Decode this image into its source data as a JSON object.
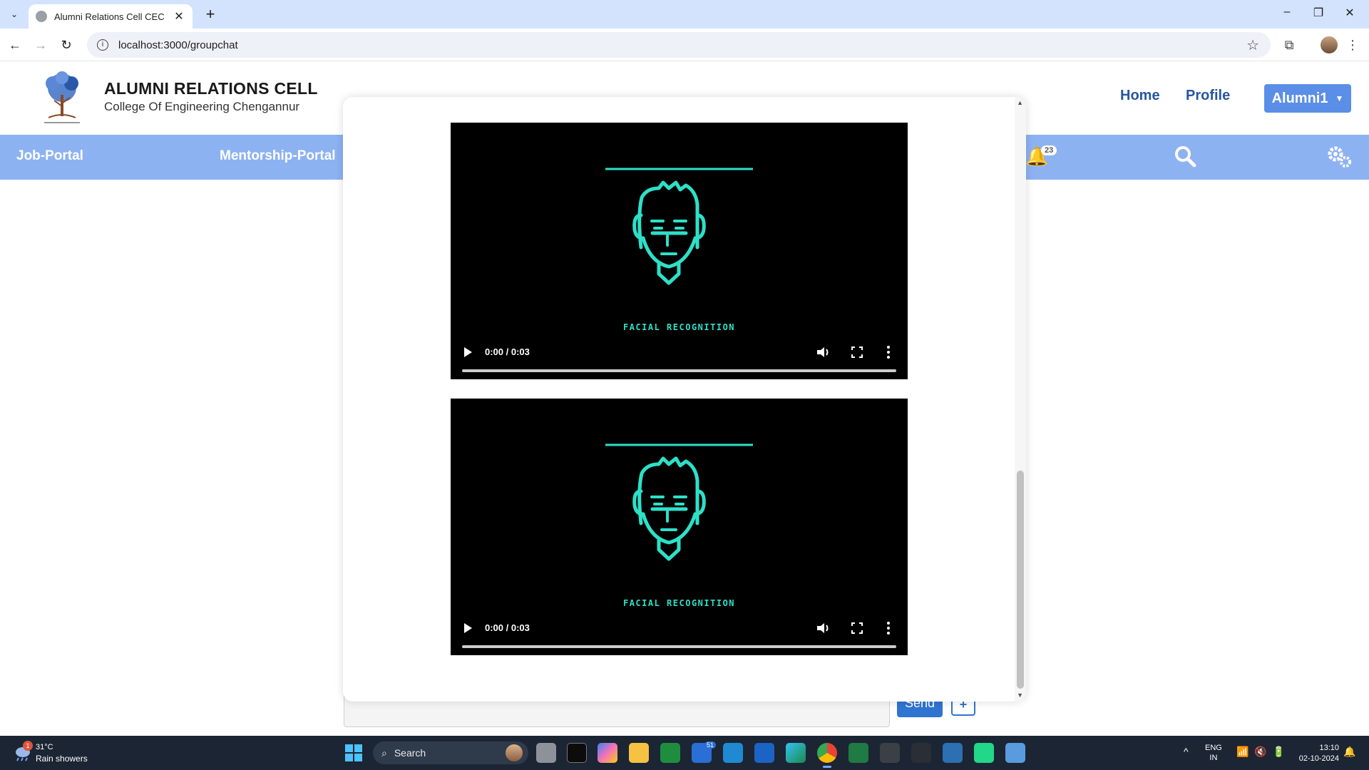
{
  "browser": {
    "tab_title": "Alumni Relations Cell CEC",
    "url": "localhost:3000/groupchat"
  },
  "header": {
    "title": "ALUMNI RELATIONS CELL",
    "subtitle": "College Of Engineering Chengannur",
    "nav": [
      "Home",
      "Profile"
    ],
    "user_button": "Alumni1"
  },
  "bluenav": {
    "links": [
      "Job-Portal",
      "Mentorship-Portal"
    ],
    "notification_count": "23"
  },
  "chat": {
    "send_label": "Send",
    "plus_label": "+"
  },
  "modal": {
    "videos": [
      {
        "caption": "FACIAL RECOGNITION",
        "time": "0:00 / 0:03",
        "progress": 0
      },
      {
        "caption": "FACIAL RECOGNITION",
        "time": "0:00 / 0:03",
        "progress": 0
      }
    ]
  },
  "taskbar": {
    "weather_temp": "31°C",
    "weather_desc": "Rain showers",
    "weather_badge": "1",
    "search_label": "Search",
    "mail_badge": "51",
    "lang_top": "ENG",
    "lang_bottom": "IN",
    "time": "13:10",
    "date": "02-10-2024"
  },
  "colors": {
    "accent": "#5b8ee6",
    "nav_bar": "#8db2f2",
    "video_art": "#2de0c8"
  }
}
